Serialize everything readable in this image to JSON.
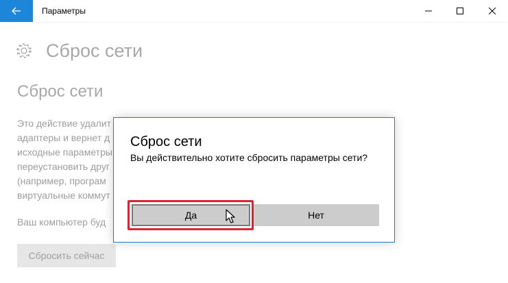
{
  "window": {
    "title": "Параметры",
    "back_icon": "back-arrow-icon",
    "controls": [
      "minimize-icon",
      "maximize-icon",
      "close-icon"
    ],
    "accent_color": "#1e86d8"
  },
  "page": {
    "header_icon": "gear-icon",
    "title": "Сброс сети",
    "section_title": "Сброс сети",
    "description_lines": [
      "Это действие удалит",
      "адаптеры и вернет д",
      "исходные параметры",
      "переустановить друг",
      "(например, програм",
      "виртуальные коммут"
    ],
    "note": "Ваш компьютер буд",
    "reset_button": "Сбросить сейчас"
  },
  "dialog": {
    "title": "Сброс сети",
    "message": "Вы действительно хотите сбросить параметры сети?",
    "yes_label": "Да",
    "no_label": "Нет",
    "highlight_color": "#e3202d",
    "border_color": "#1b79c6"
  }
}
